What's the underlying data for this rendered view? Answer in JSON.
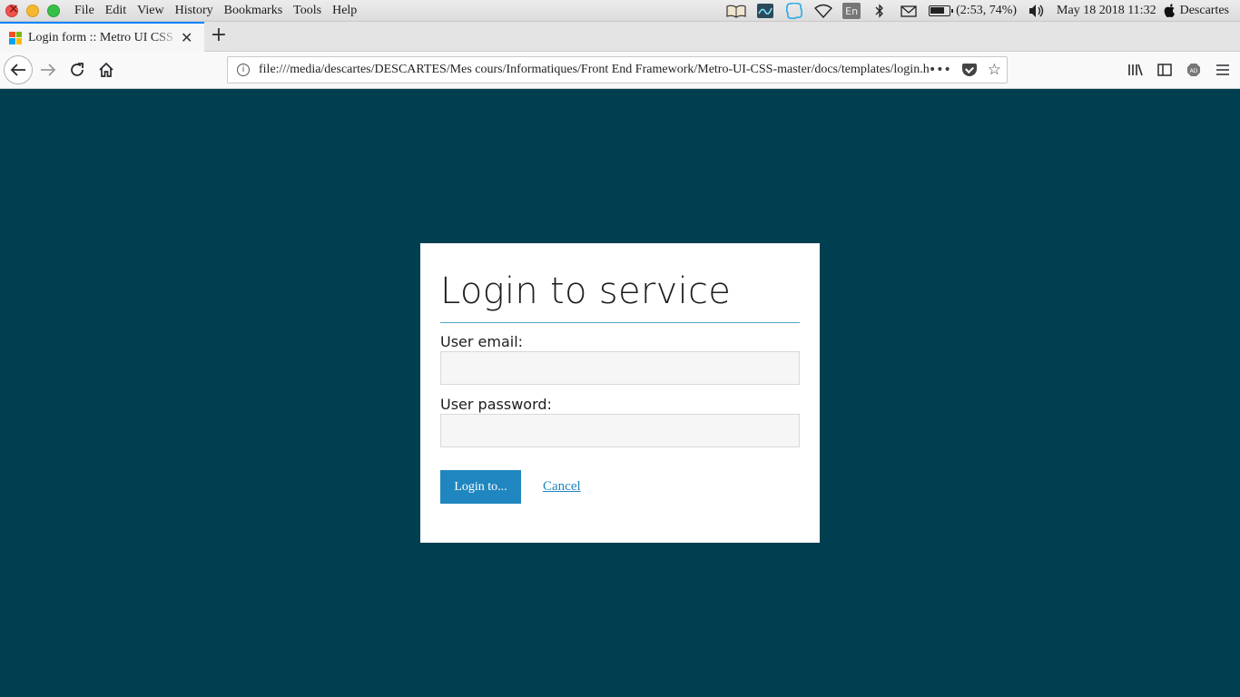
{
  "menubar": {
    "items": [
      "File",
      "Edit",
      "View",
      "History",
      "Bookmarks",
      "Tools",
      "Help"
    ],
    "tray": {
      "keyboard_layout": "En",
      "battery": "(2:53, 74%)",
      "datetime": "May 18 2018 11:32",
      "user": "Descartes"
    }
  },
  "tab": {
    "title": "Login form :: Metro UI CSS - Th",
    "favicon_colors": [
      "#f25022",
      "#7fba00",
      "#00a4ef",
      "#ffb900"
    ]
  },
  "navbar": {
    "url": "file:///media/descartes/DESCARTES/Mes cours/Informatiques/Front End Framework/Metro-UI-CSS-master/docs/templates/login.html"
  },
  "login": {
    "title": "Login to service",
    "email_label": "User email:",
    "email_value": "",
    "password_label": "User password:",
    "password_value": "",
    "submit_label": "Login to...",
    "cancel_label": "Cancel"
  },
  "colors": {
    "background": "#003f50",
    "accent": "#2086bf",
    "title_rule": "#59a2c4"
  }
}
